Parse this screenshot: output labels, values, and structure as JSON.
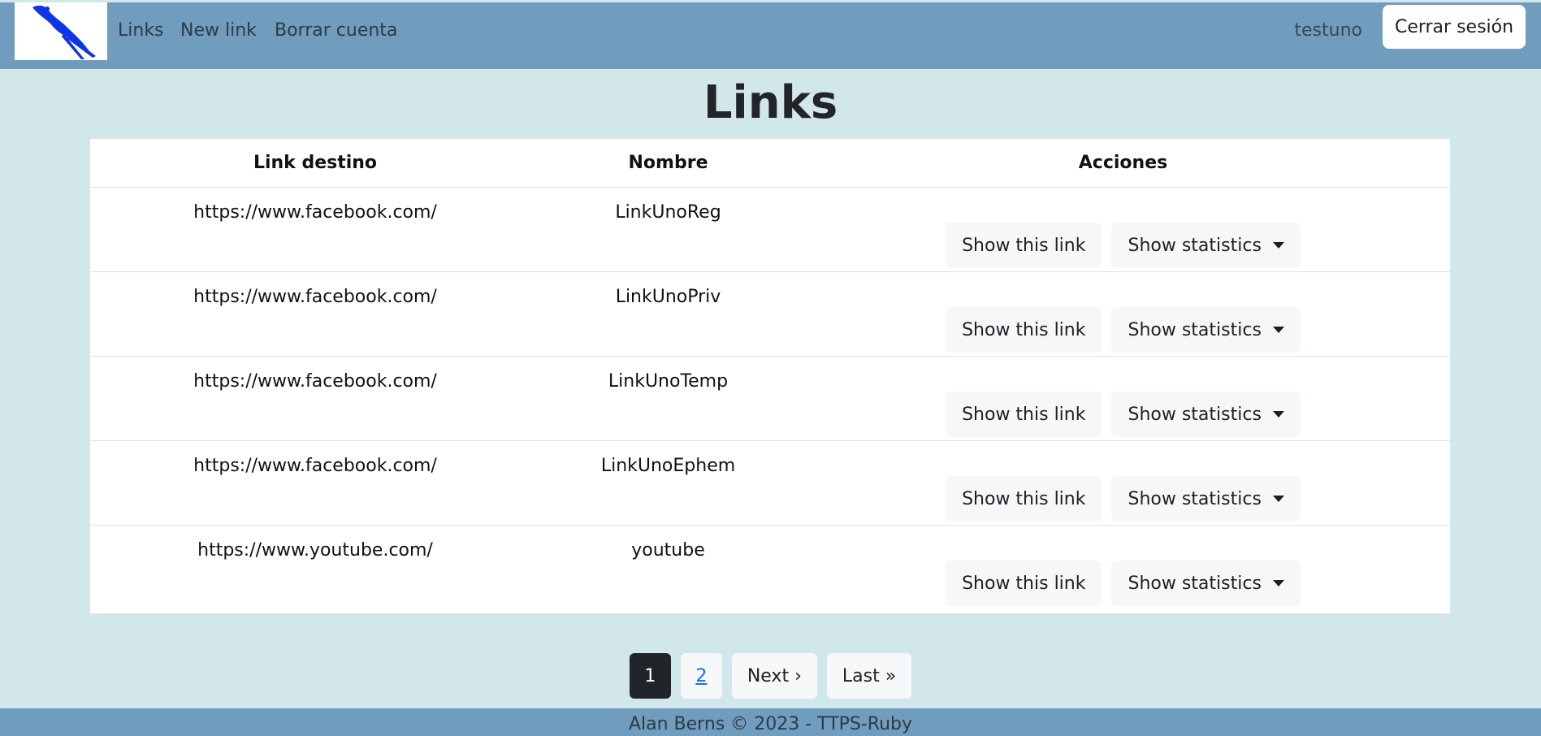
{
  "navbar": {
    "links": [
      "Links",
      "New link",
      "Borrar cuenta"
    ],
    "user": "testuno",
    "logout_label": "Cerrar sesión"
  },
  "page": {
    "title": "Links"
  },
  "table": {
    "headers": [
      "Link destino",
      "Nombre",
      "Acciones"
    ],
    "rows": [
      {
        "url": "https://www.facebook.com/",
        "name": "LinkUnoReg",
        "show_label": "Show this link",
        "stats_label": "Show statistics"
      },
      {
        "url": "https://www.facebook.com/",
        "name": "LinkUnoPriv",
        "show_label": "Show this link",
        "stats_label": "Show statistics"
      },
      {
        "url": "https://www.facebook.com/",
        "name": "LinkUnoTemp",
        "show_label": "Show this link",
        "stats_label": "Show statistics"
      },
      {
        "url": "https://www.facebook.com/",
        "name": "LinkUnoEphem",
        "show_label": "Show this link",
        "stats_label": "Show statistics"
      },
      {
        "url": "https://www.youtube.com/",
        "name": "youtube",
        "show_label": "Show this link",
        "stats_label": "Show statistics"
      }
    ]
  },
  "pagination": {
    "current": "1",
    "other": "2",
    "next": "Next ›",
    "last": "Last »"
  },
  "footer": {
    "text": "Alan Berns © 2023 - TTPS-Ruby"
  },
  "colors": {
    "navbar": "#709cbd",
    "background": "#d2e7ea",
    "logo_bird": "#1034e8"
  },
  "icons": {
    "logo": "bird-logo-icon",
    "dropdown": "caret-down-icon"
  }
}
